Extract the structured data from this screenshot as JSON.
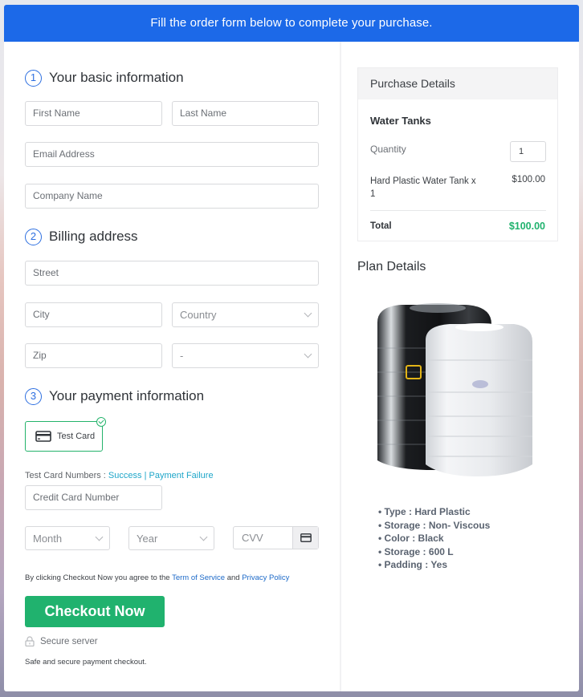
{
  "banner": {
    "text": "Fill the order form below to complete your purchase."
  },
  "form": {
    "step1": {
      "number": "1",
      "title": "Your basic information"
    },
    "first_name": {
      "placeholder": "First Name"
    },
    "last_name": {
      "placeholder": "Last Name"
    },
    "email": {
      "placeholder": "Email Address"
    },
    "company": {
      "placeholder": "Company Name"
    },
    "step2": {
      "number": "2",
      "title": "Billing address"
    },
    "street": {
      "placeholder": "Street"
    },
    "city": {
      "placeholder": "City"
    },
    "country": {
      "selected": "Country"
    },
    "zip": {
      "placeholder": "Zip"
    },
    "state": {
      "selected": "-"
    },
    "step3": {
      "number": "3",
      "title": "Your payment information"
    },
    "payment_method": {
      "label": "Test Card",
      "selected": true,
      "icon": "credit-card-icon"
    },
    "test_numbers": {
      "label": "Test Card Numbers : ",
      "success": "Success",
      "separator": "|",
      "failure": "Payment Failure"
    },
    "card_number": {
      "placeholder": "Credit Card Number"
    },
    "month": {
      "selected": "Month"
    },
    "year": {
      "selected": "Year"
    },
    "cvv": {
      "placeholder": "CVV",
      "icon": "credit-card-icon"
    },
    "agreement": {
      "prefix": "By clicking Checkout Now you agree to the ",
      "tos": "Term of Service",
      "and": " and ",
      "privacy": "Privacy Policy"
    },
    "checkout_label": "Checkout Now",
    "secure": {
      "icon": "lock-icon",
      "label": "Secure server"
    },
    "safe_text": "Safe and secure payment checkout."
  },
  "purchase": {
    "header": "Purchase Details",
    "product": "Water Tanks",
    "quantity_label": "Quantity",
    "quantity_value": "1",
    "line_item": "Hard Plastic Water Tank x 1",
    "line_price": "$100.00",
    "total_label": "Total",
    "total_value": "$100.00"
  },
  "plan": {
    "title": "Plan Details",
    "image_alt": "water tanks",
    "features": [
      "Type : Hard Plastic",
      "Storage : Non- Viscous",
      "Color : Black",
      "Storage : 600 L",
      "Padding : Yes"
    ]
  },
  "colors": {
    "primary": "#1c69e8",
    "success": "#20b26e",
    "total": "#20b26e"
  }
}
